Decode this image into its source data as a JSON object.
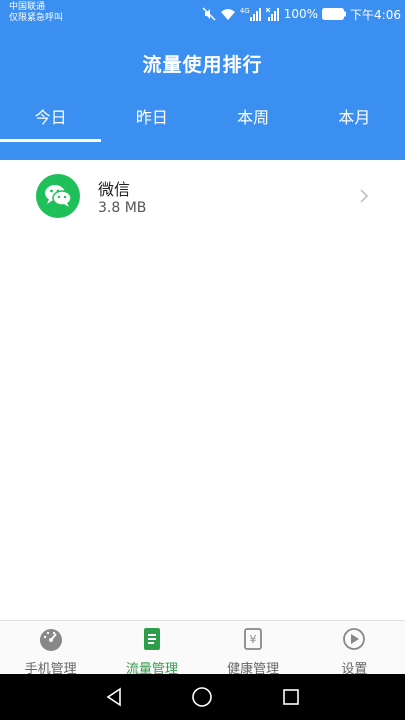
{
  "status_bar": {
    "carrier_line1": "中国联通",
    "carrier_line2": "仅限紧急呼叫",
    "battery_percent": "100%",
    "time": "下午4:06",
    "network_label": "4G"
  },
  "header": {
    "title": "流量使用排行",
    "background_color": "#3a8ff0"
  },
  "tabs": [
    {
      "label": "今日",
      "active": true
    },
    {
      "label": "昨日",
      "active": false
    },
    {
      "label": "本周",
      "active": false
    },
    {
      "label": "本月",
      "active": false
    }
  ],
  "apps": [
    {
      "name": "微信",
      "usage": "3.8 MB",
      "icon": "wechat-icon",
      "icon_color": "#1fc05a"
    }
  ],
  "bottom_nav": [
    {
      "label": "手机管理",
      "icon": "speedometer-icon",
      "active": false
    },
    {
      "label": "流量管理",
      "icon": "document-icon",
      "active": true
    },
    {
      "label": "健康管理",
      "icon": "yen-card-icon",
      "active": false
    },
    {
      "label": "设置",
      "icon": "play-circle-icon",
      "active": false
    }
  ],
  "colors": {
    "accent_green": "#2e9e4a",
    "inactive_gray": "#666666"
  }
}
